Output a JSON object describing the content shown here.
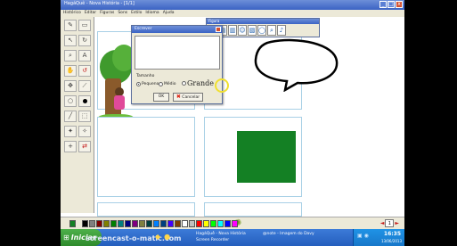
{
  "window": {
    "title": "HagáQuê - Nova História - [1/1]",
    "controls": [
      "_",
      "□",
      "x"
    ]
  },
  "menu": [
    "Histórico",
    "Editar",
    "Figuras",
    "Sons",
    "Estilo",
    "Idioma",
    "Ajuda"
  ],
  "tools": [
    {
      "name": "pencil-tool-icon",
      "glyph": "✎",
      "color": "plain"
    },
    {
      "name": "eraser-tool-icon",
      "glyph": "▭",
      "color": "plain"
    },
    {
      "name": "arrow-tool-icon",
      "glyph": "↖",
      "color": "plain"
    },
    {
      "name": "rotate-tool-icon",
      "glyph": "↻",
      "color": "plain"
    },
    {
      "name": "zoom-tool-icon",
      "glyph": "⌕",
      "color": "plain"
    },
    {
      "name": "text-tool-icon",
      "glyph": "A",
      "color": "plain"
    },
    {
      "name": "balloon-tool-icon",
      "glyph": "✋",
      "color": "plain"
    },
    {
      "name": "undo-tool-icon",
      "glyph": "↺",
      "color": "red"
    },
    {
      "name": "move-tool-icon",
      "glyph": "✥",
      "color": "plain"
    },
    {
      "name": "brush-tool-icon",
      "glyph": "⟋",
      "color": "plain"
    },
    {
      "name": "circle-tool-icon",
      "glyph": "○",
      "color": "plain"
    },
    {
      "name": "fill-tool-icon",
      "glyph": "",
      "color": "dot"
    },
    {
      "name": "line-tool-icon",
      "glyph": "╱",
      "color": "plain"
    },
    {
      "name": "select-tool-icon",
      "glyph": "⬚",
      "color": "plain"
    },
    {
      "name": "picker-tool-icon",
      "glyph": "✦",
      "color": "plain"
    },
    {
      "name": "stamp-tool-icon",
      "glyph": "✧",
      "color": "plain"
    },
    {
      "name": "add-panel-tool-icon",
      "glyph": "+",
      "color": "plain"
    },
    {
      "name": "flip-tool-icon",
      "glyph": "⇄",
      "color": "red"
    }
  ],
  "dialog": {
    "title": "Escrever",
    "size_label": "Tamanho",
    "options": [
      {
        "label": "Pequeno",
        "selected": true
      },
      {
        "label": "Médio",
        "selected": false
      },
      {
        "label": "Grande",
        "selected": false
      }
    ],
    "ok_label": "OK",
    "cancel_label": "Cancelar"
  },
  "mini_toolbar": {
    "title": "Figura",
    "icons": [
      "image-icon",
      "page-icon",
      "scene-icon",
      "character-icon",
      "object-icon",
      "balloon-icon",
      "lens-icon",
      "sound-icon"
    ]
  },
  "palette": {
    "colors": [
      "#000000",
      "#7f7f7f",
      "#7f0000",
      "#7f7f00",
      "#007f00",
      "#007f7f",
      "#00007f",
      "#7f007f",
      "#7f7f3f",
      "#003f3f",
      "#007fff",
      "#003f7f",
      "#3f00ff",
      "#7f3f00",
      "#ffffff",
      "#c0c0c0",
      "#ff0000",
      "#ffff00",
      "#00ff00",
      "#00ffff",
      "#0000ff",
      "#ff00ff"
    ],
    "current_color": "#148024",
    "page_number": "1"
  },
  "taskbar": {
    "start_label": "Iniciar",
    "watermark": "screencast-o-matic.com",
    "tasks": [
      {
        "label": "HagáQuê - Nova História",
        "sub": "Screen Recorder"
      },
      {
        "label": "@note - Imagem do Davy"
      }
    ],
    "clock": "16:35",
    "date": "13/06/2013"
  }
}
